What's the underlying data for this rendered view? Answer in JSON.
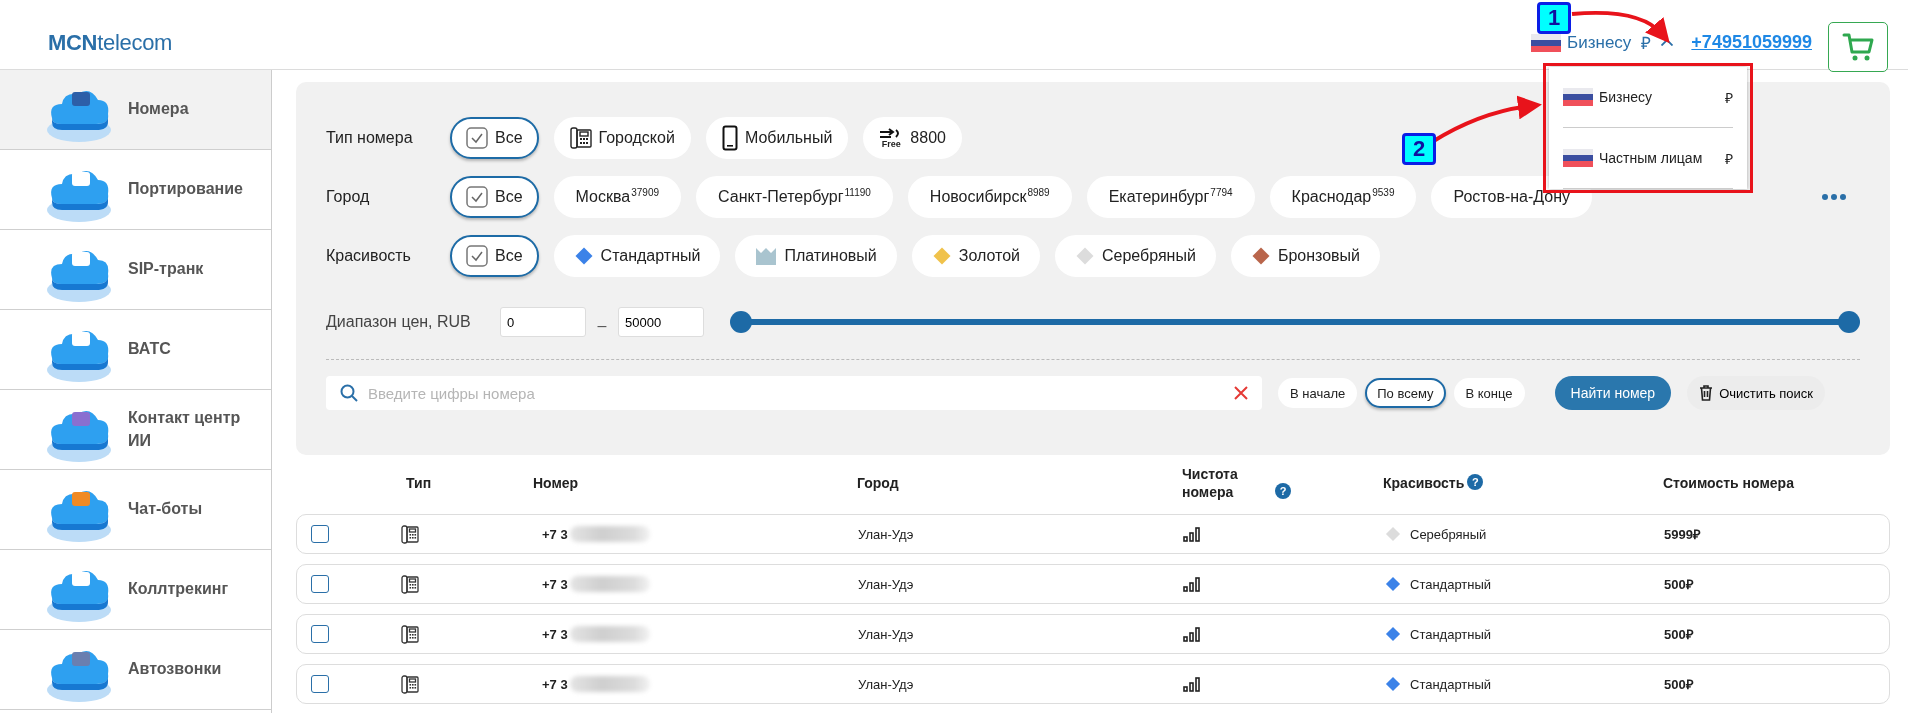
{
  "header": {
    "logo": "**MCN**telecom",
    "account": {
      "label": "Бизнесу",
      "currency": "₽",
      "expanded": true
    },
    "phone": "+74951059999"
  },
  "account_menu": {
    "items": [
      {
        "label": "Бизнесу",
        "currency": "₽"
      },
      {
        "label": "Частным лицам",
        "currency": "₽"
      }
    ]
  },
  "sidebar": {
    "items": [
      {
        "label": "Номера",
        "selected": true
      },
      {
        "label": "Портирование",
        "selected": false
      },
      {
        "label": "SIP-транк",
        "selected": false
      },
      {
        "label": "ВАТС",
        "selected": false
      },
      {
        "label": "Контакт центр ИИ",
        "selected": false
      },
      {
        "label": "Чат-боты",
        "selected": false
      },
      {
        "label": "Коллтрекинг",
        "selected": false
      },
      {
        "label": "Автозвонки",
        "selected": false
      }
    ]
  },
  "filters": {
    "rows": [
      {
        "label": "Тип номера",
        "more": false,
        "chips": [
          {
            "kind": "all",
            "label": "Все",
            "selected": true
          },
          {
            "kind": "landline",
            "label": "Городской",
            "selected": false
          },
          {
            "kind": "mobile",
            "label": "Мобильный",
            "selected": false
          },
          {
            "kind": "freephone",
            "badge": "Free",
            "label": "8800",
            "selected": false
          }
        ]
      },
      {
        "label": "Город",
        "more": true,
        "chips": [
          {
            "kind": "all",
            "label": "Все",
            "selected": true
          },
          {
            "kind": "city",
            "label": "Москва",
            "count": "37909",
            "selected": false
          },
          {
            "kind": "city",
            "label": "Санкт-Петербург",
            "count": "11190",
            "selected": false
          },
          {
            "kind": "city",
            "label": "Новосибирск",
            "count": "8989",
            "selected": false
          },
          {
            "kind": "city",
            "label": "Екатеринбург",
            "count": "7794",
            "selected": false
          },
          {
            "kind": "city",
            "label": "Краснодар",
            "count": "9539",
            "selected": false
          },
          {
            "kind": "city",
            "label": "Ростов-на-Дону",
            "selected": false
          }
        ]
      },
      {
        "label": "Красивость",
        "more": false,
        "chips": [
          {
            "kind": "all",
            "label": "Все",
            "selected": true
          },
          {
            "kind": "diamond",
            "label": "Стандартный",
            "color": "#3b82e8",
            "selected": false
          },
          {
            "kind": "crown",
            "label": "Платиновый",
            "color": "#a9c4cf",
            "selected": false
          },
          {
            "kind": "diamond",
            "label": "Золотой",
            "color": "#f0c24b",
            "selected": false
          },
          {
            "kind": "diamond",
            "label": "Серебряный",
            "color": "#dcdcdc",
            "selected": false
          },
          {
            "kind": "diamond",
            "label": "Бронзовый",
            "color": "#b9654b",
            "selected": false
          }
        ]
      }
    ],
    "price": {
      "label": "Диапазон цен, RUB",
      "min": "0",
      "separator": "–",
      "max": "50000",
      "thumbs": [
        {
          "level": 0
        },
        {
          "level": 1
        }
      ]
    }
  },
  "search": {
    "placeholder": "Введите цифры номера",
    "modes": [
      {
        "label": "В начале",
        "selected": false
      },
      {
        "label": "По всему",
        "selected": true
      },
      {
        "label": "В конце",
        "selected": false
      }
    ],
    "find_button": "Найти номер",
    "clear_button": "Очистить поиск"
  },
  "table": {
    "columns": [
      {
        "label": "Тип",
        "help": false
      },
      {
        "label": "Номер",
        "help": false
      },
      {
        "label": "Город",
        "help": false
      },
      {
        "label": "Чистота номера",
        "help": true
      },
      {
        "label": "Красивость",
        "help": true
      },
      {
        "label": "Стоимость номера",
        "help": false
      }
    ],
    "help_mark": "?",
    "rows": [
      {
        "checked": false,
        "number": "+7 3",
        "city": "Улан-Удэ",
        "beauty": "Серебряный",
        "color": "#dcdcdc",
        "price": "5999₽"
      },
      {
        "checked": false,
        "number": "+7 3",
        "city": "Улан-Удэ",
        "beauty": "Стандартный",
        "color": "#3b82e8",
        "price": "500₽"
      },
      {
        "checked": false,
        "number": "+7 3",
        "city": "Улан-Удэ",
        "beauty": "Стандартный",
        "color": "#3b82e8",
        "price": "500₽"
      },
      {
        "checked": false,
        "number": "+7 3",
        "city": "Улан-Удэ",
        "beauty": "Стандартный",
        "color": "#3b82e8",
        "price": "500₽"
      }
    ]
  },
  "annotations": [
    {
      "label": "1"
    },
    {
      "label": "2"
    }
  ]
}
